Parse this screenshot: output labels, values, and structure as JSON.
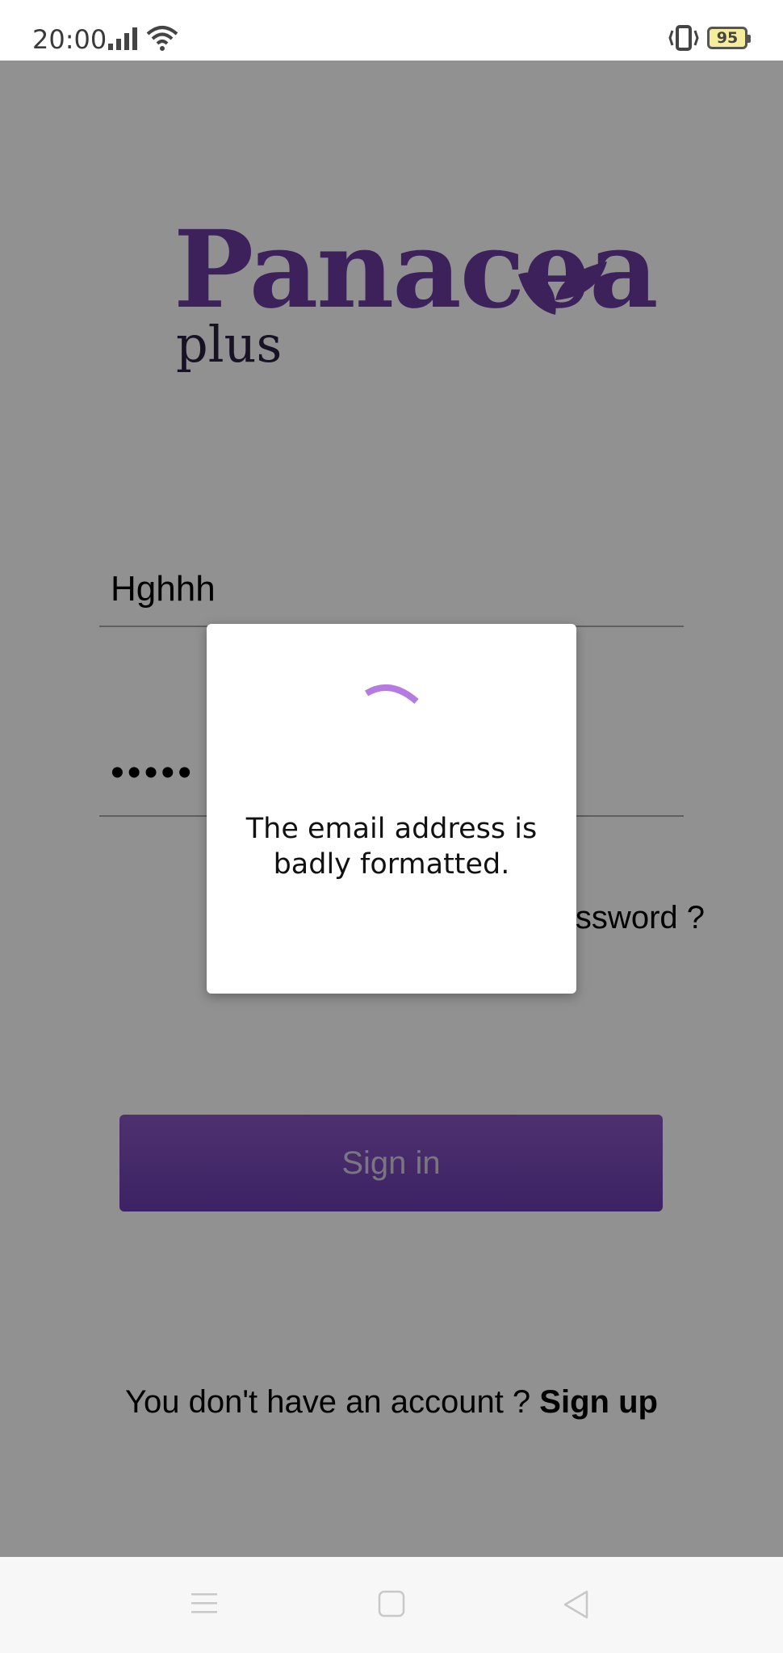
{
  "status_bar": {
    "time": "20:00",
    "battery_level": "95",
    "icons": [
      "signal-icon",
      "wifi-icon",
      "vibrate-icon",
      "battery-icon"
    ]
  },
  "logo": {
    "main_text": "Panacea",
    "sub_text": "plus",
    "brand_color": "#6b3aa0"
  },
  "login_form": {
    "email_value": "Hghhh",
    "password_value": "•••••",
    "forgot_password_label": "assword ?",
    "signin_label": "Sign in",
    "signup_prompt": "You don't have an account ? ",
    "signup_label": "Sign up"
  },
  "dialog": {
    "message": "The email address is badly formatted.",
    "spinner_color": "#b57be0"
  },
  "nav_bar": {
    "icons": [
      "menu-icon",
      "home-icon",
      "back-icon"
    ]
  }
}
